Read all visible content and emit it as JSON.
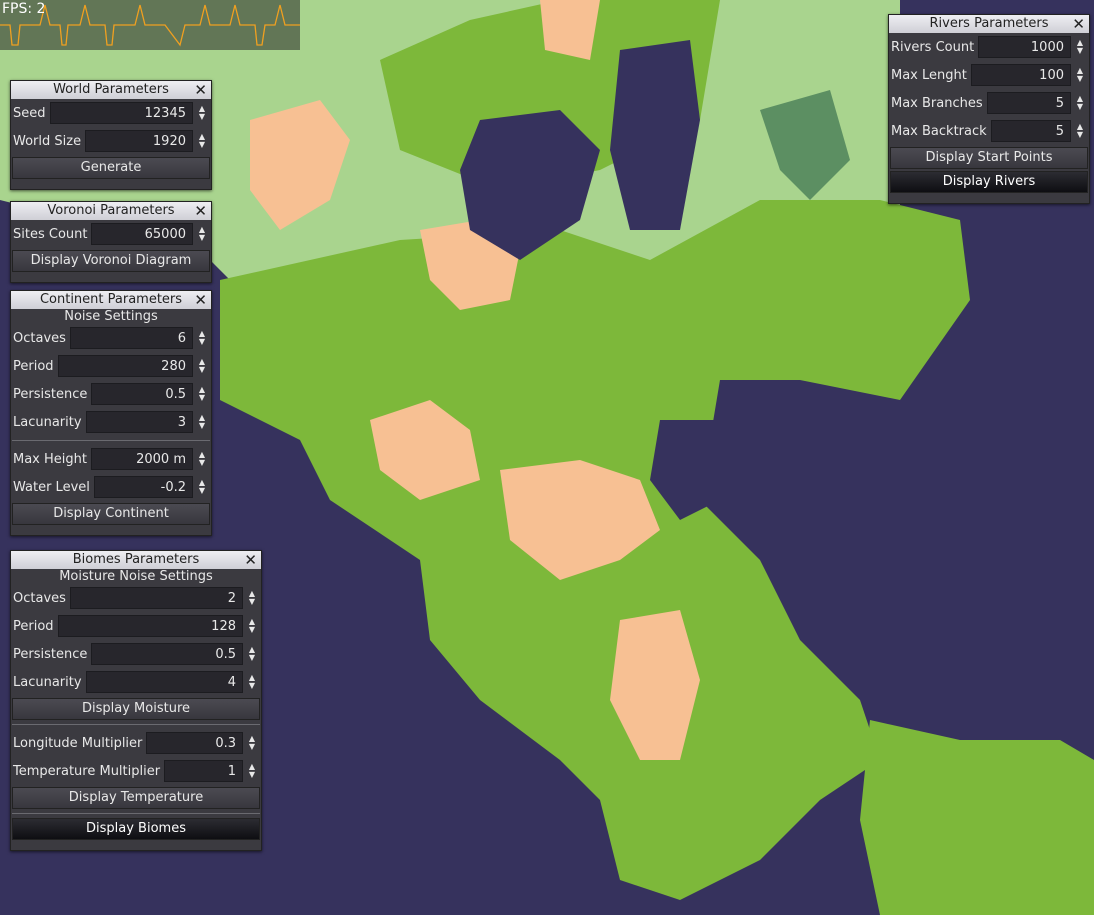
{
  "fps": {
    "label": "FPS: 2"
  },
  "colors": {
    "water": "#36325d",
    "grass": "#7db83a",
    "light_grass": "#a9d48e",
    "sand": "#f7c093",
    "forest": "#5c8f62"
  },
  "world": {
    "title": "World Parameters",
    "seed_label": "Seed",
    "seed": "12345",
    "size_label": "World Size",
    "size": "1920",
    "generate": "Generate"
  },
  "voronoi": {
    "title": "Voronoi Parameters",
    "sites_label": "Sites Count",
    "sites": "65000",
    "display": "Display Voronoi Diagram"
  },
  "continent": {
    "title": "Continent Parameters",
    "noise": "Noise Settings",
    "octaves_label": "Octaves",
    "octaves": "6",
    "period_label": "Period",
    "period": "280",
    "persistence_label": "Persistence",
    "persistence": "0.5",
    "lacunarity_label": "Lacunarity",
    "lacunarity": "3",
    "max_height_label": "Max Height",
    "max_height": "2000 m",
    "water_label": "Water Level",
    "water": "-0.2",
    "display": "Display Continent"
  },
  "biomes": {
    "title": "Biomes Parameters",
    "noise": "Moisture Noise Settings",
    "octaves_label": "Octaves",
    "octaves": "2",
    "period_label": "Period",
    "period": "128",
    "persistence_label": "Persistence",
    "persistence": "0.5",
    "lacunarity_label": "Lacunarity",
    "lacunarity": "4",
    "display_moisture": "Display Moisture",
    "longitude_label": "Longitude Multiplier",
    "longitude": "0.3",
    "temperature_label": "Temperature Multiplier",
    "temperature": "1",
    "display_temperature": "Display Temperature",
    "display_biomes": "Display Biomes"
  },
  "rivers": {
    "title": "Rivers Parameters",
    "count_label": "Rivers Count",
    "count": "1000",
    "length_label": "Max Lenght",
    "length": "100",
    "branches_label": "Max Branches",
    "branches": "5",
    "backtrack_label": "Max Backtrack",
    "backtrack": "5",
    "display_start": "Display Start Points",
    "display_rivers": "Display Rivers"
  }
}
